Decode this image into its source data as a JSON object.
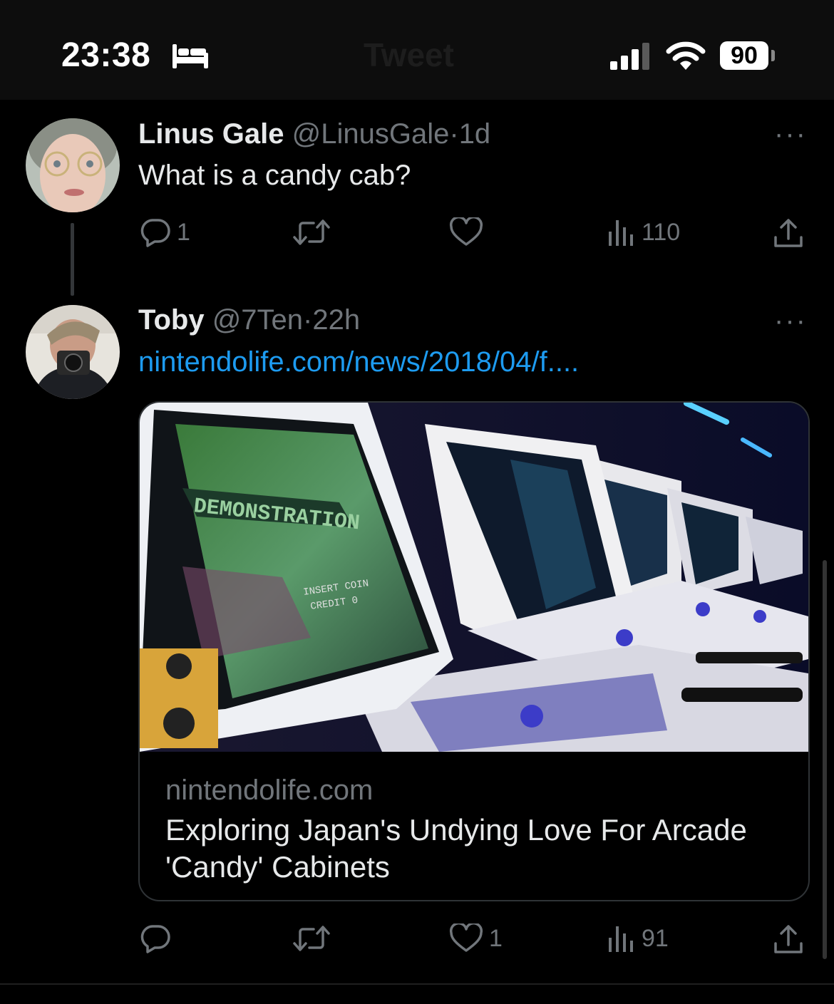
{
  "status_bar": {
    "time": "23:38",
    "battery": "90",
    "background_title": "Tweet"
  },
  "tweets": [
    {
      "author_name": "Linus Gale",
      "handle": "@LinusGale",
      "separator": "·",
      "age": "1d",
      "text": "What is a candy cab?",
      "more": "···",
      "actions": {
        "replies": "1",
        "retweets": "",
        "likes": "",
        "views": "110"
      }
    },
    {
      "author_name": "Toby",
      "handle": "@7Ten",
      "separator": "·",
      "age": "22h",
      "link_text": "nintendolife.com/news/2018/04/f....",
      "more": "···",
      "card": {
        "domain": "nintendolife.com",
        "title": "Exploring Japan's Undying Love For Arcade 'Candy' Cabinets",
        "image_texts": {
          "demonstration": "DEMONSTRATION",
          "insert_coin": "INSERT COIN",
          "credit": "CREDIT 0"
        }
      },
      "actions": {
        "replies": "",
        "retweets": "",
        "likes": "1",
        "views": "91"
      }
    }
  ],
  "colors": {
    "accent": "#1d9bf0",
    "muted": "#71767b",
    "text": "#e7e9ea"
  },
  "icons": [
    "bed-icon",
    "signal-icon",
    "wifi-icon",
    "reply-icon",
    "retweet-icon",
    "like-icon",
    "views-icon",
    "share-icon"
  ]
}
